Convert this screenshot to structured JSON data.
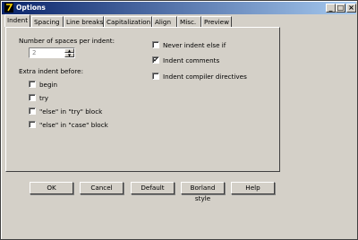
{
  "window": {
    "title": "Options",
    "controls": {
      "minimize": "_",
      "maximize": "□",
      "close": "×"
    }
  },
  "tabs": [
    {
      "label": "Indent",
      "active": true
    },
    {
      "label": "Spacing"
    },
    {
      "label": "Line breaks"
    },
    {
      "label": "Capitalization"
    },
    {
      "label": "Align"
    },
    {
      "label": "Misc."
    },
    {
      "label": "Preview"
    }
  ],
  "indent": {
    "spaces_label": "Number of spaces per indent:",
    "spaces_value": "2",
    "extra_label": "Extra indent before:",
    "extra_options": [
      {
        "label": "begin",
        "checked": false
      },
      {
        "label": "try",
        "checked": false
      },
      {
        "label": "\"else\" in \"try\" block",
        "checked": false
      },
      {
        "label": "\"else\" in \"case\" block",
        "checked": false
      }
    ],
    "right_options": [
      {
        "label": "Never indent else if",
        "checked": false
      },
      {
        "label": "Indent comments",
        "checked": true
      },
      {
        "label": "Indent compiler directives",
        "checked": false
      }
    ]
  },
  "buttons": {
    "ok": "OK",
    "cancel": "Cancel",
    "default": "Default",
    "borland": "Borland style",
    "help": "Help"
  },
  "icons": {
    "app": "app-icon",
    "check": "✔"
  }
}
